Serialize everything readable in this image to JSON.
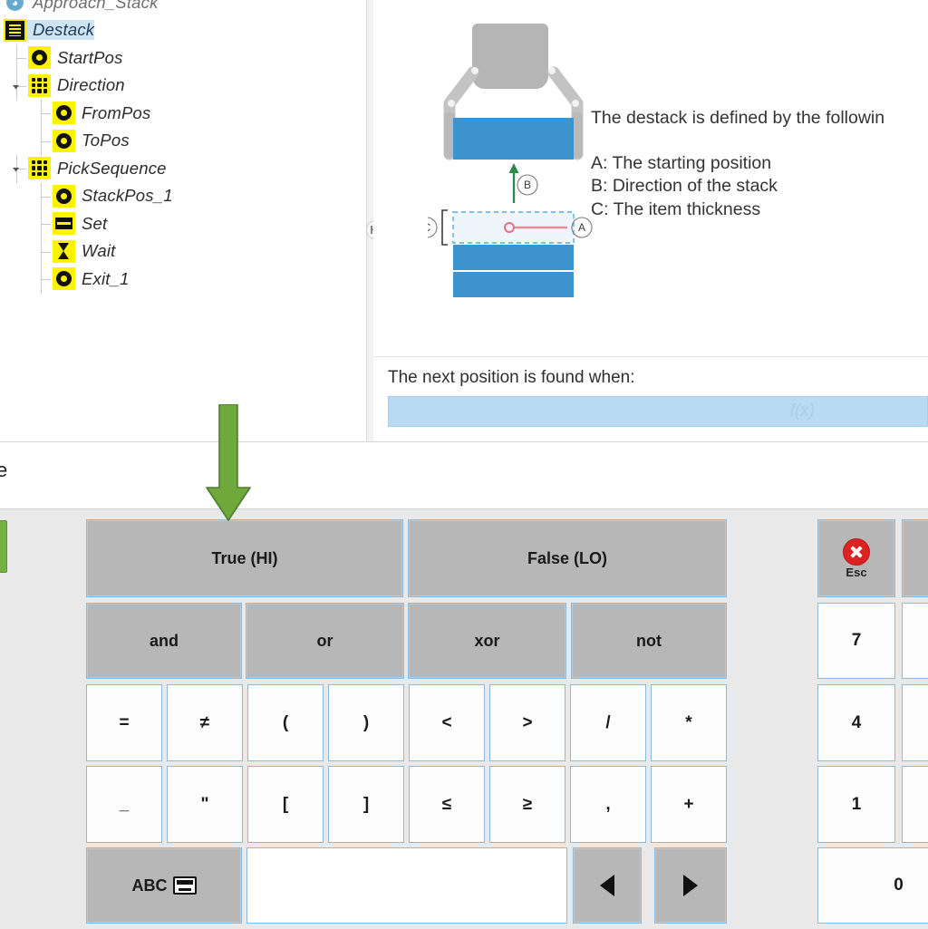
{
  "tree": {
    "items": [
      {
        "label": "Approach_Stack",
        "icon": "program-node-icon",
        "indent": 0,
        "clipped": true,
        "selected": false,
        "twisty": "none"
      },
      {
        "label": "Destack",
        "icon": "destack-node-icon",
        "indent": 0,
        "clipped": false,
        "selected": true,
        "twisty": "none"
      },
      {
        "label": "StartPos",
        "icon": "waypoint-icon",
        "indent": 1,
        "clipped": false,
        "selected": false,
        "twisty": "none"
      },
      {
        "label": "Direction",
        "icon": "grid-node-icon",
        "indent": 1,
        "clipped": false,
        "selected": false,
        "twisty": "expanded"
      },
      {
        "label": "FromPos",
        "icon": "waypoint-icon",
        "indent": 2,
        "clipped": false,
        "selected": false,
        "twisty": "none"
      },
      {
        "label": "ToPos",
        "icon": "waypoint-icon",
        "indent": 2,
        "clipped": false,
        "selected": false,
        "twisty": "none"
      },
      {
        "label": "PickSequence",
        "icon": "grid-node-icon",
        "indent": 1,
        "clipped": false,
        "selected": false,
        "twisty": "expanded"
      },
      {
        "label": "StackPos_1",
        "icon": "waypoint-icon",
        "indent": 2,
        "clipped": false,
        "selected": false,
        "twisty": "none"
      },
      {
        "label": "Set",
        "icon": "set-icon",
        "indent": 2,
        "clipped": false,
        "selected": false,
        "twisty": "none"
      },
      {
        "label": "Wait",
        "icon": "hourglass-icon",
        "indent": 2,
        "clipped": false,
        "selected": false,
        "twisty": "none"
      },
      {
        "label": "Exit_1",
        "icon": "waypoint-icon",
        "indent": 2,
        "clipped": false,
        "selected": false,
        "twisty": "none"
      }
    ]
  },
  "detail": {
    "lead": "The destack is defined by the followin",
    "legend": [
      "A: The starting position",
      "B: Direction of the stack",
      "C: The item thickness"
    ],
    "callouts": {
      "a": "A",
      "b": "B",
      "c": "C"
    },
    "next_position_label": "The next position is found when:",
    "fx_placeholder": "f(x)",
    "fx_value": ""
  },
  "mid_band": {
    "clipped_text": "e"
  },
  "keyboard": {
    "bool_row": [
      "True (HI)",
      "False (LO)"
    ],
    "logic_row": [
      "and",
      "or",
      "xor",
      "not"
    ],
    "symbol_row_1": [
      "=",
      "≠",
      "(",
      ")",
      "<",
      ">",
      "/",
      "*"
    ],
    "symbol_row_2": [
      "_",
      "\"",
      "[",
      "]",
      "≤",
      "≥",
      ",",
      "+"
    ],
    "bottom_row": {
      "abc_label": "ABC",
      "abc_icon": "keyboard-icon",
      "text_value": "",
      "left_arrow": "left-arrow-icon",
      "right_arrow": "right-arrow-icon"
    },
    "numpad": {
      "esc_label": "Esc",
      "esc_icon": "close-circle-icon",
      "keys": [
        "7",
        "4",
        "1",
        "0"
      ]
    }
  },
  "colors": {
    "accent_blue": "#8fb9d6",
    "key_gray": "#b7b7b7",
    "selection_blue": "#cfe4f3",
    "node_yellow": "#fdf200",
    "field_blue": "#b9dbf2",
    "green_arrow": "#6fa93c",
    "esc_red": "#dd2222",
    "stack_blue": "#3d93cd"
  }
}
